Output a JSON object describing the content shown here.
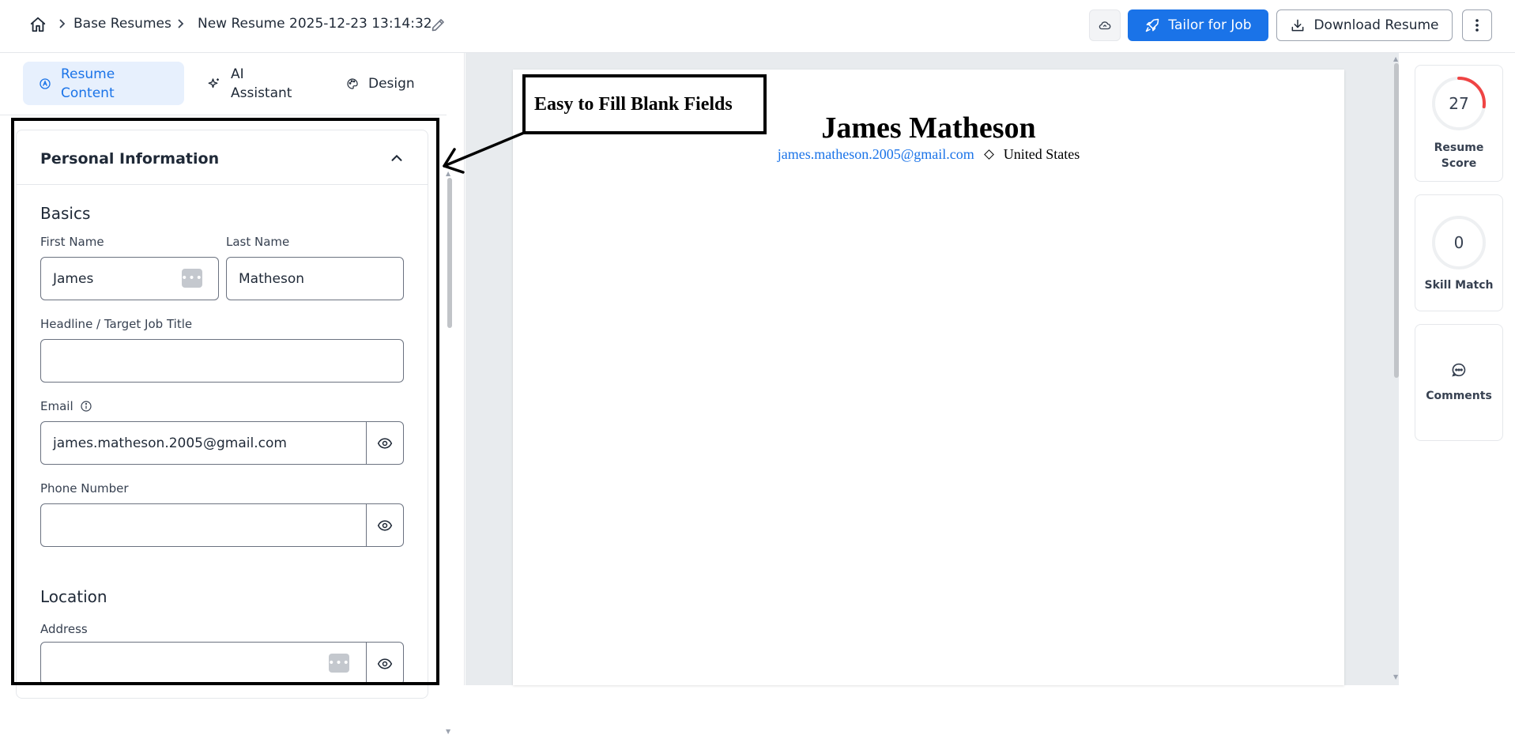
{
  "header": {
    "breadcrumb": [
      "Base Resumes",
      "New Resume 2025-12-23 13:14:32"
    ],
    "tailor_label": "Tailor for Job",
    "download_label": "Download Resume",
    "colors": {
      "primary": "#1a73e8"
    }
  },
  "tabs": [
    {
      "label": "Resume Content",
      "icon": "content-icon",
      "active": true
    },
    {
      "label": "AI Assistant",
      "icon": "sparkle-icon",
      "active": false
    },
    {
      "label": "Design",
      "icon": "palette-icon",
      "active": false
    }
  ],
  "form": {
    "section_title": "Personal Information",
    "basics_heading": "Basics",
    "first_name": {
      "label": "First Name",
      "value": "James"
    },
    "last_name": {
      "label": "Last Name",
      "value": "Matheson"
    },
    "headline": {
      "label": "Headline / Target Job Title",
      "value": ""
    },
    "email": {
      "label": "Email",
      "value": "james.matheson.2005@gmail.com"
    },
    "phone": {
      "label": "Phone Number",
      "value": ""
    },
    "location_heading": "Location",
    "address": {
      "label": "Address",
      "value": ""
    }
  },
  "resume": {
    "name": "James Matheson",
    "email": "james.matheson.2005@gmail.com",
    "country": "United States"
  },
  "annotation": {
    "text": "Easy to Fill Blank Fields"
  },
  "rail": {
    "resume_score": {
      "value": 27,
      "max": 100,
      "label": "Resume Score",
      "color": "#ef4444"
    },
    "skill_match": {
      "value": 0,
      "label": "Skill Match"
    },
    "comments": {
      "label": "Comments"
    }
  }
}
